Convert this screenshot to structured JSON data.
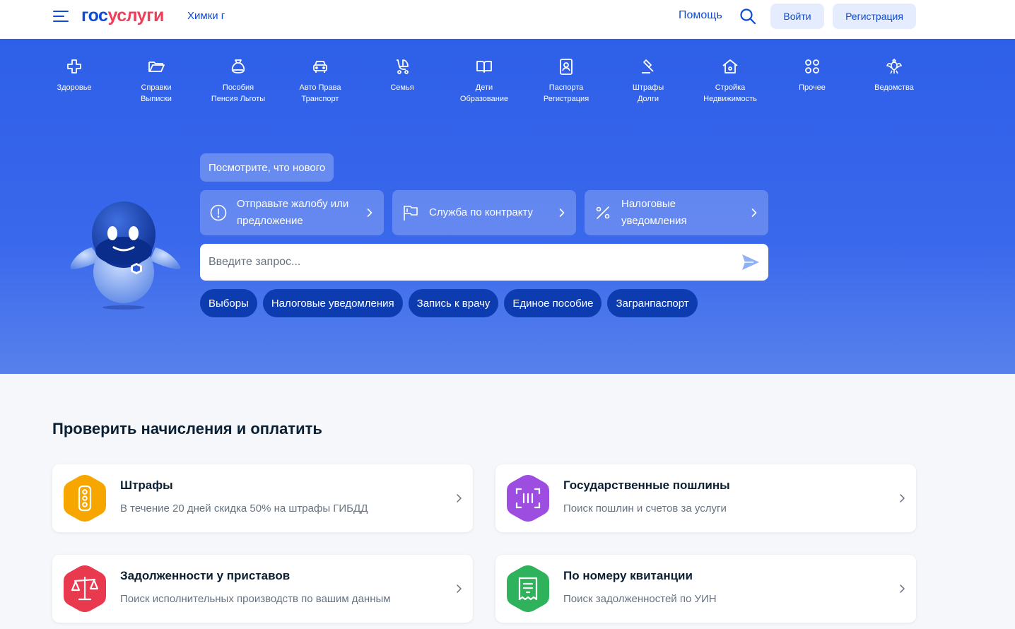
{
  "header": {
    "logo_part1": "гос",
    "logo_part2": "услуги",
    "city": "Химки г",
    "help": "Помощь",
    "login": "Войти",
    "register": "Регистрация"
  },
  "categories": [
    {
      "label": "Здоровье",
      "icon": "health-cross-icon"
    },
    {
      "label": "Справки\nВыписки",
      "icon": "folder-icon"
    },
    {
      "label": "Пособия\nПенсия Льготы",
      "icon": "money-bag-icon"
    },
    {
      "label": "Авто Права\nТранспорт",
      "icon": "car-icon"
    },
    {
      "label": "Семья",
      "icon": "stroller-icon"
    },
    {
      "label": "Дети\nОбразование",
      "icon": "book-icon"
    },
    {
      "label": "Паспорта\nРегистрация",
      "icon": "passport-icon"
    },
    {
      "label": "Штрафы\nДолги",
      "icon": "gavel-icon"
    },
    {
      "label": "Стройка\nНедвижимость",
      "icon": "house-icon"
    },
    {
      "label": "Прочее",
      "icon": "grid-icon"
    },
    {
      "label": "Ведомства",
      "icon": "coat-of-arms-icon"
    }
  ],
  "hero": {
    "news_button": "Посмотрите, что нового",
    "cards": [
      {
        "label": "Отправьте жалобу или предложение",
        "icon": "exclamation-circle-icon"
      },
      {
        "label": "Служба по контракту",
        "icon": "flag-icon"
      },
      {
        "label": "Налоговые уведомления",
        "icon": "percent-icon"
      }
    ],
    "search_placeholder": "Введите запрос...",
    "chips": [
      "Выборы",
      "Налоговые уведомления",
      "Запись к врачу",
      "Единое пособие",
      "Загранпаспорт"
    ]
  },
  "payments": {
    "title": "Проверить начисления и оплатить",
    "items": [
      {
        "title": "Штрафы",
        "desc": "В течение 20 дней скидка 50% на штрафы ГИБДД",
        "color": "#f7a600",
        "icon": "traffic-light-icon"
      },
      {
        "title": "Государственные пошлины",
        "desc": "Поиск пошлин и счетов за услуги",
        "color": "#9d4ee0",
        "icon": "barcode-scan-icon"
      },
      {
        "title": "Задолженности у приставов",
        "desc": "Поиск исполнительных производств по вашим данным",
        "color": "#e9394f",
        "icon": "scales-icon"
      },
      {
        "title": "По номеру квитанции",
        "desc": "Поиск задолженностей по УИН",
        "color": "#2fb25c",
        "icon": "receipt-icon"
      }
    ]
  },
  "colors": {
    "brand_blue": "#0d4cd3",
    "brand_red": "#ee3f58",
    "hero_blue": "#2e5fe8",
    "chip_dark": "#0d3cb1"
  }
}
